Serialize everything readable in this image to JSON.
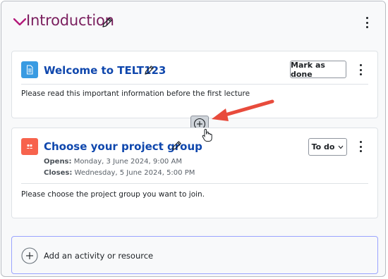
{
  "section": {
    "title": "Introduction"
  },
  "activities": [
    {
      "title": "Welcome to TELT123",
      "action_label": "Mark as done",
      "description": "Please read this important information before the first lecture",
      "icon": "page-icon"
    },
    {
      "title": "Choose your project group",
      "action_label": "To do",
      "opens_label": "Opens:",
      "opens_value": "Monday, 3 June 2024, 9:00 AM",
      "closes_label": "Closes:",
      "closes_value": "Wednesday, 5 June 2024, 5:00 PM",
      "description": "Please choose the project group you want to join.",
      "icon": "group-choice-icon"
    }
  ],
  "add_activity": {
    "label": "Add an activity or resource"
  },
  "colors": {
    "section_title": "#7a1f5e",
    "activity_title": "#0f47ad",
    "page_icon": "#399be2",
    "choice_icon": "#f7634d",
    "annotation_arrow": "#e84b3c"
  }
}
